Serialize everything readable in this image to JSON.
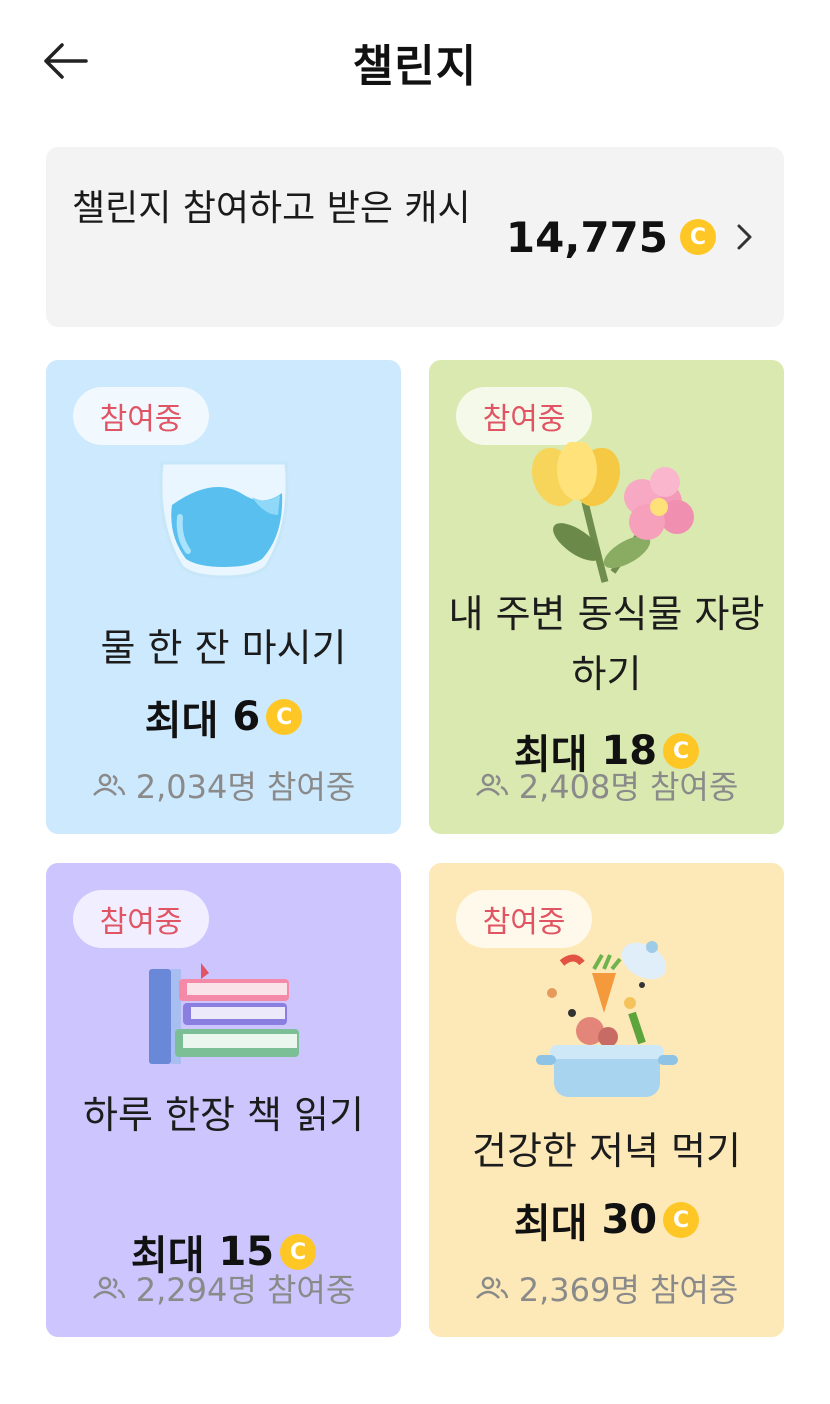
{
  "header": {
    "title": "챌린지",
    "back_icon": "arrow-left-icon"
  },
  "cash_summary": {
    "label": "챌린지 참여하고 받은 캐시",
    "amount": "14,775",
    "coin_symbol": "C",
    "chevron_icon": "chevron-right-icon"
  },
  "challenges": [
    {
      "badge": "참여중",
      "title": "물 한 잔 마시기",
      "reward_prefix": "최대",
      "reward": "6",
      "participants": "2,034명 참여중",
      "icon": "water-glass-icon",
      "bg_color": "#cde9fe"
    },
    {
      "badge": "참여중",
      "title": "내 주변 동식물 자랑하기",
      "reward_prefix": "최대",
      "reward": "18",
      "participants": "2,408명 참여중",
      "icon": "flowers-icon",
      "bg_color": "#d9e9b0"
    },
    {
      "badge": "참여중",
      "title": "하루 한장 책 읽기",
      "reward_prefix": "최대",
      "reward": "15",
      "participants": "2,294명 참여중",
      "icon": "books-icon",
      "bg_color": "#cdc6fe"
    },
    {
      "badge": "참여중",
      "title": "건강한 저녁 먹기",
      "reward_prefix": "최대",
      "reward": "30",
      "participants": "2,369명 참여중",
      "icon": "cooking-pot-icon",
      "bg_color": "#fde9b8"
    }
  ],
  "colors": {
    "coin": "#ffc726",
    "badge_text": "#e05463"
  }
}
